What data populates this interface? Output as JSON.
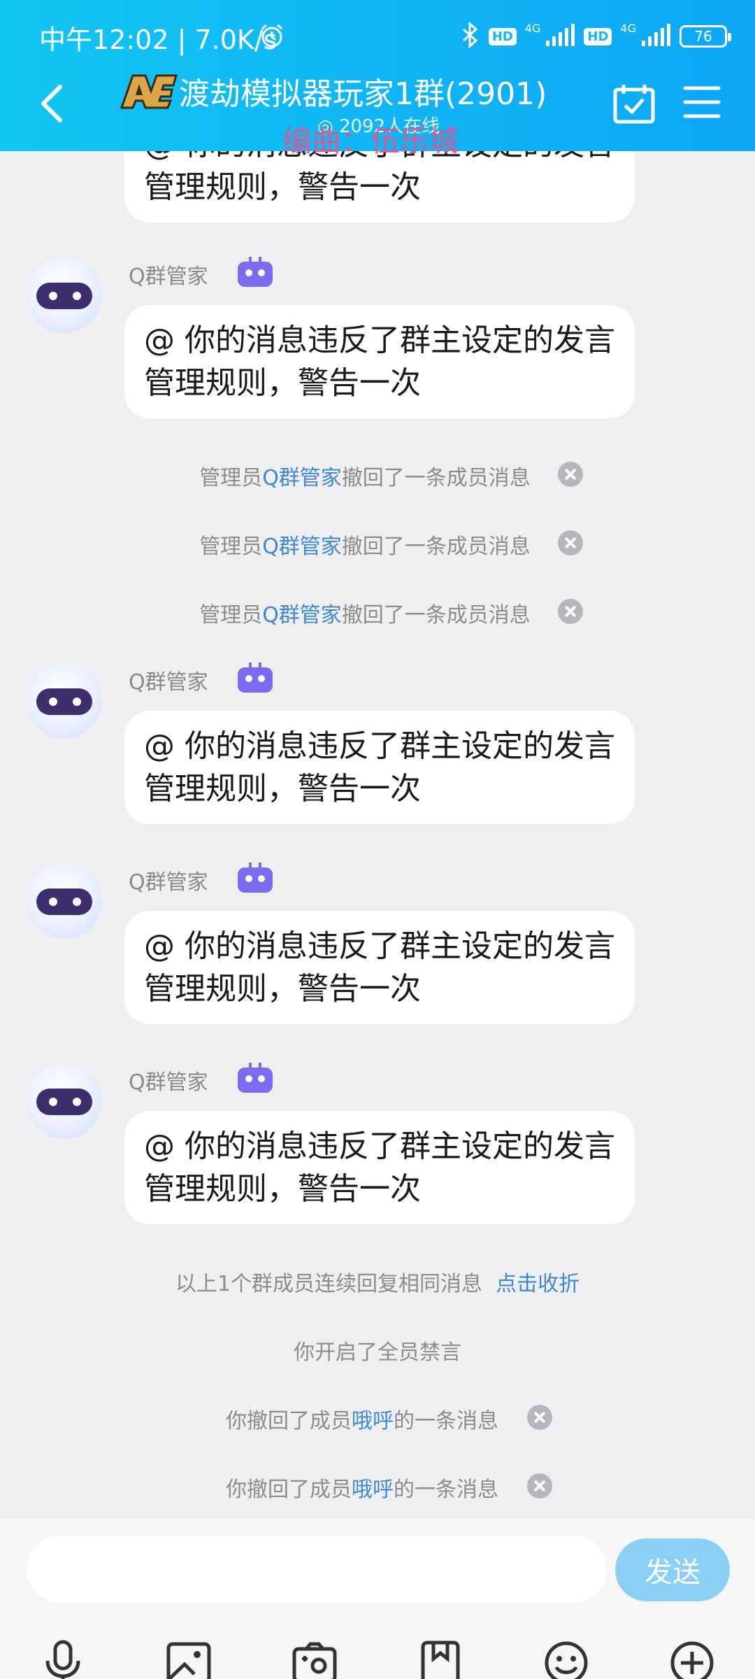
{
  "status_bar": {
    "time": "中午12:02 | 7.0K/s",
    "hd1": "HD",
    "net1": "4G",
    "hd2": "HD",
    "net2": "4G",
    "battery": "76"
  },
  "header": {
    "title": "渡劫模拟器玩家1群(2901)",
    "online": "◎ 2092人在线",
    "watermark": "编曲：伍乐城",
    "icons": [
      "back-arrow-icon",
      "ace-logo",
      "calendar-check-icon",
      "menu-icon"
    ]
  },
  "colors": {
    "header_bg": "#12c6f2",
    "link": "#3f88d8",
    "send_button": "#8ccff5",
    "watermark": "#e0578e"
  },
  "messages": {
    "partial_bubble": "@ 你的消息违反了群主设定的发言管理规则，警告一次",
    "bot_sender": "Q群管家",
    "bot_text": "@ 你的消息违反了群主设定的发言管理规则，警告一次",
    "recall_pre": "管理员",
    "recall_name": "Q群管家",
    "recall_post": "撤回了一条成员消息",
    "collapse_text": "以上1个群成员连续回复相同消息",
    "collapse_link": "点击收折",
    "mute_all": "你开启了全员禁言",
    "self_recall_pre": "你撤回了成员",
    "self_recall_name": "哦呼",
    "self_recall_post": "的一条消息"
  },
  "input": {
    "value": "",
    "placeholder": "",
    "send_label": "发送"
  },
  "toolbar": [
    "microphone-icon",
    "image-icon",
    "camera-icon",
    "file-icon",
    "emoji-icon",
    "plus-icon"
  ]
}
